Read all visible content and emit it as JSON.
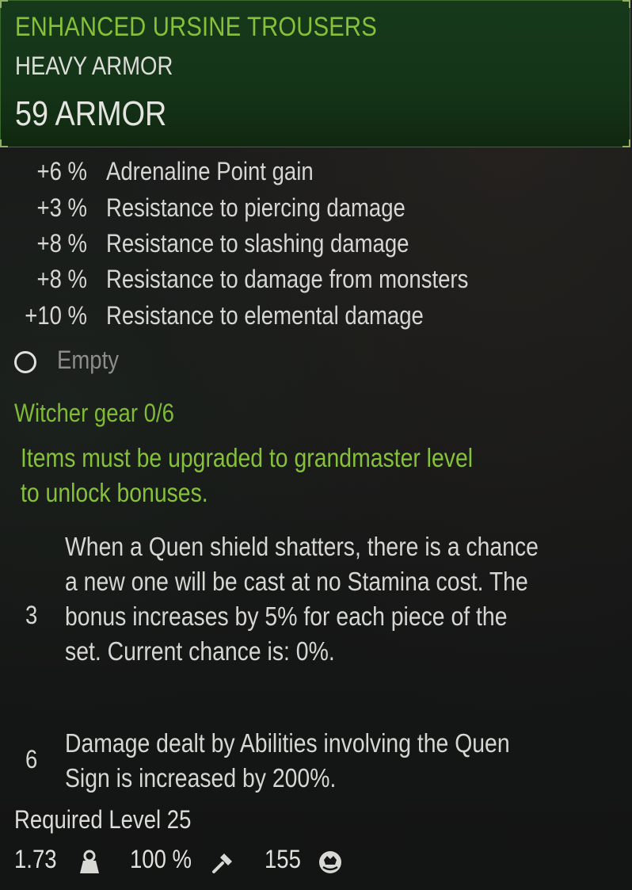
{
  "item": {
    "name": "ENHANCED URSINE TROUSERS",
    "type": "HEAVY ARMOR",
    "armor": "59 ARMOR"
  },
  "stats": [
    {
      "value": "+6 %",
      "name": "Adrenaline Point gain"
    },
    {
      "value": "+3 %",
      "name": "Resistance to piercing damage"
    },
    {
      "value": "+8 %",
      "name": "Resistance to slashing damage"
    },
    {
      "value": "+8 %",
      "name": "Resistance to damage from monsters"
    },
    {
      "value": "+10 %",
      "name": "Resistance to elemental damage"
    }
  ],
  "slot": {
    "label": "Empty"
  },
  "set": {
    "title": "Witcher gear 0/6",
    "note": "Items must be upgraded to grandmaster level to unlock bonuses.",
    "bonuses": [
      {
        "pieces": "3",
        "text": "When a Quen shield shatters, there is a chance a new one will be cast at no Stamina cost. The bonus increases by 5% for each piece of the set. Current chance is: 0%."
      },
      {
        "pieces": "6",
        "text": "Damage dealt by Abilities involving the Quen Sign is increased by 200%."
      }
    ]
  },
  "required_level": "Required Level 25",
  "footer": {
    "weight": "1.73",
    "weight_icon": "weight-icon",
    "durability": "100 %",
    "durability_icon": "hammer-icon",
    "price": "155",
    "price_icon": "coin-icon"
  },
  "colors": {
    "accent_green": "#86c13a",
    "header_bg": "#17391a",
    "text": "#d6d6d2",
    "muted": "#8d8d88"
  }
}
